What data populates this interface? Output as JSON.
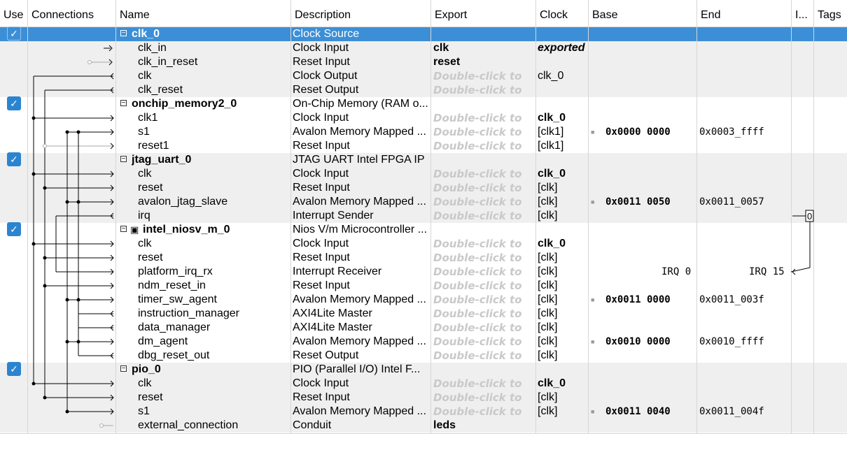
{
  "headers": {
    "use": "Use",
    "connections": "Connections",
    "name": "Name",
    "description": "Description",
    "export": "Export",
    "clock": "Clock",
    "base": "Base",
    "end": "End",
    "irq": "I...",
    "tags": "Tags"
  },
  "rows": [
    {
      "kind": "component",
      "name": "clk_0",
      "description": "Clock Source",
      "export": "",
      "clock": "",
      "base": "",
      "end": "",
      "checked": true,
      "selected": true
    },
    {
      "kind": "interface",
      "name": "clk_in",
      "description": "Clock Input",
      "export": "clk",
      "clock": "exported",
      "base": "",
      "end": ""
    },
    {
      "kind": "interface",
      "name": "clk_in_reset",
      "description": "Reset Input",
      "export": "reset",
      "clock": "",
      "base": "",
      "end": ""
    },
    {
      "kind": "interface",
      "name": "clk",
      "description": "Clock Output",
      "export": "Double-click to",
      "clock": "clk_0",
      "base": "",
      "end": ""
    },
    {
      "kind": "interface",
      "name": "clk_reset",
      "description": "Reset Output",
      "export": "Double-click to",
      "clock": "",
      "base": "",
      "end": ""
    },
    {
      "kind": "component",
      "name": "onchip_memory2_0",
      "description": "On-Chip Memory (RAM o...",
      "export": "",
      "clock": "",
      "base": "",
      "end": "",
      "checked": true
    },
    {
      "kind": "interface",
      "name": "clk1",
      "description": "Clock Input",
      "export": "Double-click to",
      "clock": "clk_0",
      "base": "",
      "end": ""
    },
    {
      "kind": "interface",
      "name": "s1",
      "description": "Avalon Memory Mapped ...",
      "export": "Double-click to",
      "clock": "[clk1]",
      "base": "0x0000 0000",
      "end": "0x0003_ffff"
    },
    {
      "kind": "interface",
      "name": "reset1",
      "description": "Reset Input",
      "export": "Double-click to",
      "clock": "[clk1]",
      "base": "",
      "end": ""
    },
    {
      "kind": "component",
      "name": "jtag_uart_0",
      "description": "JTAG UART Intel FPGA IP",
      "export": "",
      "clock": "",
      "base": "",
      "end": "",
      "checked": true
    },
    {
      "kind": "interface",
      "name": "clk",
      "description": "Clock Input",
      "export": "Double-click to",
      "clock": "clk_0",
      "base": "",
      "end": ""
    },
    {
      "kind": "interface",
      "name": "reset",
      "description": "Reset Input",
      "export": "Double-click to",
      "clock": "[clk]",
      "base": "",
      "end": ""
    },
    {
      "kind": "interface",
      "name": "avalon_jtag_slave",
      "description": "Avalon Memory Mapped ...",
      "export": "Double-click to",
      "clock": "[clk]",
      "base": "0x0011 0050",
      "end": "0x0011_0057"
    },
    {
      "kind": "interface",
      "name": "irq",
      "description": "Interrupt Sender",
      "export": "Double-click to",
      "clock": "[clk]",
      "base": "",
      "end": ""
    },
    {
      "kind": "component",
      "name": "intel_niosv_m_0",
      "description": "Nios V/m Microcontroller ...",
      "export": "",
      "clock": "",
      "base": "",
      "end": "",
      "checked": true,
      "cpu": true
    },
    {
      "kind": "interface",
      "name": "clk",
      "description": "Clock Input",
      "export": "Double-click to",
      "clock": "clk_0",
      "base": "",
      "end": ""
    },
    {
      "kind": "interface",
      "name": "reset",
      "description": "Reset Input",
      "export": "Double-click to",
      "clock": "[clk]",
      "base": "",
      "end": ""
    },
    {
      "kind": "interface",
      "name": "platform_irq_rx",
      "description": "Interrupt Receiver",
      "export": "Double-click to",
      "clock": "[clk]",
      "base": "IRQ 0",
      "end": "IRQ 15"
    },
    {
      "kind": "interface",
      "name": "ndm_reset_in",
      "description": "Reset Input",
      "export": "Double-click to",
      "clock": "[clk]",
      "base": "",
      "end": ""
    },
    {
      "kind": "interface",
      "name": "timer_sw_agent",
      "description": "Avalon Memory Mapped ...",
      "export": "Double-click to",
      "clock": "[clk]",
      "base": "0x0011 0000",
      "end": "0x0011_003f"
    },
    {
      "kind": "interface",
      "name": "instruction_manager",
      "description": "AXI4Lite Master",
      "export": "Double-click to",
      "clock": "[clk]",
      "base": "",
      "end": ""
    },
    {
      "kind": "interface",
      "name": "data_manager",
      "description": "AXI4Lite Master",
      "export": "Double-click to",
      "clock": "[clk]",
      "base": "",
      "end": ""
    },
    {
      "kind": "interface",
      "name": "dm_agent",
      "description": "Avalon Memory Mapped ...",
      "export": "Double-click to",
      "clock": "[clk]",
      "base": "0x0010 0000",
      "end": "0x0010_ffff"
    },
    {
      "kind": "interface",
      "name": "dbg_reset_out",
      "description": "Reset Output",
      "export": "Double-click to",
      "clock": "[clk]",
      "base": "",
      "end": ""
    },
    {
      "kind": "component",
      "name": "pio_0",
      "description": "PIO (Parallel I/O) Intel F...",
      "export": "",
      "clock": "",
      "base": "",
      "end": "",
      "checked": true
    },
    {
      "kind": "interface",
      "name": "clk",
      "description": "Clock Input",
      "export": "Double-click to",
      "clock": "clk_0",
      "base": "",
      "end": ""
    },
    {
      "kind": "interface",
      "name": "reset",
      "description": "Reset Input",
      "export": "Double-click to",
      "clock": "[clk]",
      "base": "",
      "end": ""
    },
    {
      "kind": "interface",
      "name": "s1",
      "description": "Avalon Memory Mapped ...",
      "export": "Double-click to",
      "clock": "[clk]",
      "base": "0x0011 0040",
      "end": "0x0011_004f"
    },
    {
      "kind": "interface",
      "name": "external_connection",
      "description": "Conduit",
      "export": "leds",
      "clock": "",
      "base": "",
      "end": ""
    }
  ],
  "irq_column": {
    "value": "0"
  },
  "colors": {
    "selection": "#3c8fd6",
    "shade": "#efefef",
    "checkbox": "#2b84d0",
    "placeholder": "#c9c9c9"
  }
}
